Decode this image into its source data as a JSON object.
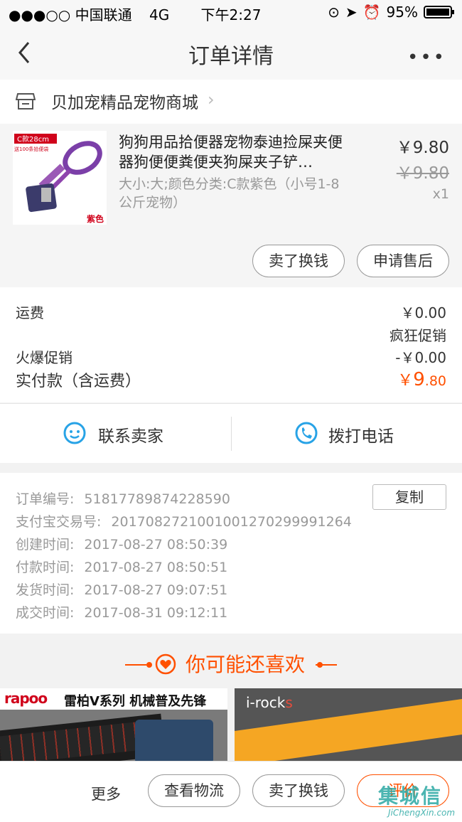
{
  "status_bar": {
    "carrier": "●●●○○ 中国联通",
    "network": "4G",
    "time": "下午2:27",
    "battery": "95%"
  },
  "nav": {
    "title": "订单详情",
    "more": "•••"
  },
  "shop": {
    "name": "贝加宠精品宠物商城",
    "chevron": "›"
  },
  "product": {
    "title": "狗狗用品拾便器宠物泰迪捡屎夹便器狗便便粪便夹狗屎夹子铲…",
    "sku": "大小:大;颜色分类:C款紫色（小号1-8公斤宠物）",
    "price": "￥9.80",
    "original_price": "￥9.80",
    "quantity": "x1",
    "thumb_badge": "C款28cm",
    "thumb_caption": "送100条拾便袋",
    "thumb_color_label": "紫色",
    "buttons": {
      "resell": "卖了换钱",
      "after_sale": "申请售后"
    }
  },
  "summary": {
    "shipping_label": "运费",
    "shipping_value": "￥0.00",
    "promo_name": "疯狂促销",
    "promo_label": "火爆促销",
    "promo_value": "-￥0.00",
    "paid_label": "实付款（含运费）",
    "paid_symbol": "￥",
    "paid_int": "9",
    "paid_dec": ".80"
  },
  "contact": {
    "seller": "联系卖家",
    "phone": "拨打电话"
  },
  "order_info": {
    "copy_button": "复制",
    "rows": [
      {
        "label": "订单编号:",
        "value": "51817789874228590"
      },
      {
        "label": "支付宝交易号:",
        "value": "2017082721001001270299991264"
      },
      {
        "label": "创建时间:",
        "value": "2017-08-27 08:50:39"
      },
      {
        "label": "付款时间:",
        "value": "2017-08-27 08:50:51"
      },
      {
        "label": "发货时间:",
        "value": "2017-08-27 09:07:51"
      },
      {
        "label": "成交时间:",
        "value": "2017-08-31 09:12:11"
      }
    ]
  },
  "recommend": {
    "title": "你可能还喜欢",
    "card1": {
      "logo": "rapoo",
      "slogan": "雷柏V系列 机械普及先锋"
    },
    "card2": {
      "logo_main": "i-rock",
      "logo_s": "s"
    }
  },
  "bottom_bar": {
    "more": "更多",
    "logistics": "查看物流",
    "resell": "卖了换钱",
    "review": "评价"
  },
  "watermark": {
    "text": "集城信",
    "url": "JiChengXin.com"
  },
  "colors": {
    "accent": "#ff5000",
    "contact_icon": "#28a3e6",
    "watermark": "#2ca9a4"
  }
}
